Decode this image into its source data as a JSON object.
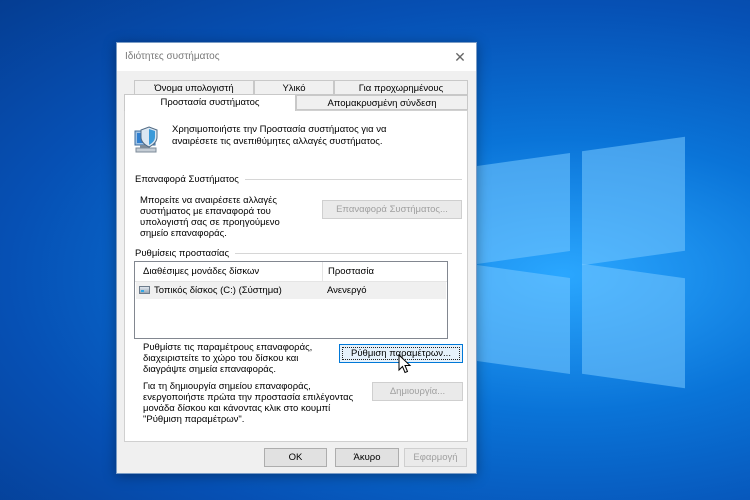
{
  "dialog": {
    "title": "Ιδιότητες συστήματος",
    "tabs_row1": [
      "Όνομα υπολογιστή",
      "Υλικό",
      "Για προχωρημένους"
    ],
    "tabs_row2": [
      "Προστασία συστήματος",
      "Απομακρυσμένη σύνδεση"
    ],
    "active_tab": "Προστασία συστήματος",
    "intro_text": [
      "Χρησιμοποιήστε την Προστασία συστήματος για να",
      "αναιρέσετε τις ανεπιθύμητες αλλαγές συστήματος."
    ],
    "restore": {
      "header": "Επαναφορά Συστήματος",
      "text": [
        "Μπορείτε να αναιρέσετε αλλαγές",
        "συστήματος με επαναφορά του",
        "υπολογιστή σας σε προηγούμενο",
        "σημείο επαναφοράς."
      ],
      "button": "Επαναφορά Συστήματος..."
    },
    "settings": {
      "header": "Ρυθμίσεις προστασίας",
      "col_drives": "Διαθέσιμες μονάδες δίσκων",
      "col_protection": "Προστασία",
      "rows": [
        {
          "drive": "Τοπικός δίσκος (C:) (Σύστημα)",
          "protection": "Ανενεργό"
        }
      ]
    },
    "configure": {
      "text": [
        "Ρυθμίστε τις παραμέτρους επαναφοράς,",
        "διαχειριστείτε το χώρο του δίσκου και",
        "διαγράψτε σημεία επαναφοράς."
      ],
      "button": "Ρύθμιση παραμέτρων..."
    },
    "create": {
      "text": [
        "Για τη δημιουργία σημείου επαναφοράς,",
        "ενεργοποιήστε πρώτα την προστασία επιλέγοντας",
        "μονάδα δίσκου και κάνοντας κλικ στο κουμπί",
        "\"Ρύθμιση παραμέτρων\"."
      ],
      "button": "Δημιουργία..."
    },
    "footer": {
      "ok": "OK",
      "cancel": "Άκυρο",
      "apply": "Εφαρμογή"
    }
  }
}
